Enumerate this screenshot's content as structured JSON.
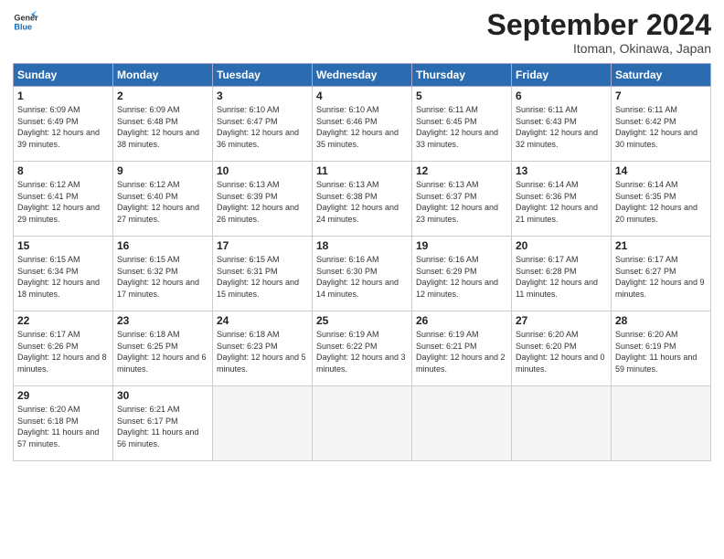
{
  "header": {
    "logo_line1": "General",
    "logo_line2": "Blue",
    "month": "September 2024",
    "location": "Itoman, Okinawa, Japan"
  },
  "weekdays": [
    "Sunday",
    "Monday",
    "Tuesday",
    "Wednesday",
    "Thursday",
    "Friday",
    "Saturday"
  ],
  "weeks": [
    [
      {
        "day": "1",
        "sunrise": "6:09 AM",
        "sunset": "6:49 PM",
        "daylight": "12 hours and 39 minutes."
      },
      {
        "day": "2",
        "sunrise": "6:09 AM",
        "sunset": "6:48 PM",
        "daylight": "12 hours and 38 minutes."
      },
      {
        "day": "3",
        "sunrise": "6:10 AM",
        "sunset": "6:47 PM",
        "daylight": "12 hours and 36 minutes."
      },
      {
        "day": "4",
        "sunrise": "6:10 AM",
        "sunset": "6:46 PM",
        "daylight": "12 hours and 35 minutes."
      },
      {
        "day": "5",
        "sunrise": "6:11 AM",
        "sunset": "6:45 PM",
        "daylight": "12 hours and 33 minutes."
      },
      {
        "day": "6",
        "sunrise": "6:11 AM",
        "sunset": "6:43 PM",
        "daylight": "12 hours and 32 minutes."
      },
      {
        "day": "7",
        "sunrise": "6:11 AM",
        "sunset": "6:42 PM",
        "daylight": "12 hours and 30 minutes."
      }
    ],
    [
      {
        "day": "8",
        "sunrise": "6:12 AM",
        "sunset": "6:41 PM",
        "daylight": "12 hours and 29 minutes."
      },
      {
        "day": "9",
        "sunrise": "6:12 AM",
        "sunset": "6:40 PM",
        "daylight": "12 hours and 27 minutes."
      },
      {
        "day": "10",
        "sunrise": "6:13 AM",
        "sunset": "6:39 PM",
        "daylight": "12 hours and 26 minutes."
      },
      {
        "day": "11",
        "sunrise": "6:13 AM",
        "sunset": "6:38 PM",
        "daylight": "12 hours and 24 minutes."
      },
      {
        "day": "12",
        "sunrise": "6:13 AM",
        "sunset": "6:37 PM",
        "daylight": "12 hours and 23 minutes."
      },
      {
        "day": "13",
        "sunrise": "6:14 AM",
        "sunset": "6:36 PM",
        "daylight": "12 hours and 21 minutes."
      },
      {
        "day": "14",
        "sunrise": "6:14 AM",
        "sunset": "6:35 PM",
        "daylight": "12 hours and 20 minutes."
      }
    ],
    [
      {
        "day": "15",
        "sunrise": "6:15 AM",
        "sunset": "6:34 PM",
        "daylight": "12 hours and 18 minutes."
      },
      {
        "day": "16",
        "sunrise": "6:15 AM",
        "sunset": "6:32 PM",
        "daylight": "12 hours and 17 minutes."
      },
      {
        "day": "17",
        "sunrise": "6:15 AM",
        "sunset": "6:31 PM",
        "daylight": "12 hours and 15 minutes."
      },
      {
        "day": "18",
        "sunrise": "6:16 AM",
        "sunset": "6:30 PM",
        "daylight": "12 hours and 14 minutes."
      },
      {
        "day": "19",
        "sunrise": "6:16 AM",
        "sunset": "6:29 PM",
        "daylight": "12 hours and 12 minutes."
      },
      {
        "day": "20",
        "sunrise": "6:17 AM",
        "sunset": "6:28 PM",
        "daylight": "12 hours and 11 minutes."
      },
      {
        "day": "21",
        "sunrise": "6:17 AM",
        "sunset": "6:27 PM",
        "daylight": "12 hours and 9 minutes."
      }
    ],
    [
      {
        "day": "22",
        "sunrise": "6:17 AM",
        "sunset": "6:26 PM",
        "daylight": "12 hours and 8 minutes."
      },
      {
        "day": "23",
        "sunrise": "6:18 AM",
        "sunset": "6:25 PM",
        "daylight": "12 hours and 6 minutes."
      },
      {
        "day": "24",
        "sunrise": "6:18 AM",
        "sunset": "6:23 PM",
        "daylight": "12 hours and 5 minutes."
      },
      {
        "day": "25",
        "sunrise": "6:19 AM",
        "sunset": "6:22 PM",
        "daylight": "12 hours and 3 minutes."
      },
      {
        "day": "26",
        "sunrise": "6:19 AM",
        "sunset": "6:21 PM",
        "daylight": "12 hours and 2 minutes."
      },
      {
        "day": "27",
        "sunrise": "6:20 AM",
        "sunset": "6:20 PM",
        "daylight": "12 hours and 0 minutes."
      },
      {
        "day": "28",
        "sunrise": "6:20 AM",
        "sunset": "6:19 PM",
        "daylight": "11 hours and 59 minutes."
      }
    ],
    [
      {
        "day": "29",
        "sunrise": "6:20 AM",
        "sunset": "6:18 PM",
        "daylight": "11 hours and 57 minutes."
      },
      {
        "day": "30",
        "sunrise": "6:21 AM",
        "sunset": "6:17 PM",
        "daylight": "11 hours and 56 minutes."
      },
      null,
      null,
      null,
      null,
      null
    ]
  ]
}
